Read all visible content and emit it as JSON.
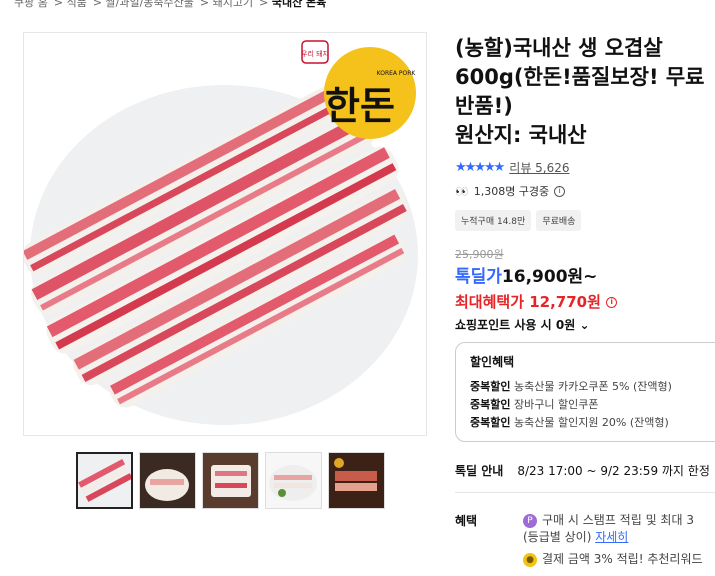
{
  "breadcrumb": [
    "쿠팡 홈",
    "식품",
    "쌀/과일/농축수산물",
    "돼지고기",
    "국내산 돈육"
  ],
  "product": {
    "title": "(농할)국내산 생 오겹살 600g(한돈!품질보장! 무료반품!)",
    "origin": "원산지: 국내산",
    "brand_badge": "우리 돼지",
    "brand_logo_text": "한돈",
    "brand_logo_sub": "KOREA PORK"
  },
  "rating": {
    "stars": "★★★★★",
    "score": 5,
    "review_label": "리뷰 5,626"
  },
  "viewing": "1,308명 구경중",
  "badges": [
    "누적구매 14.8만",
    "무료배송"
  ],
  "price": {
    "original": "25,900원",
    "deal_label": "톡딜가",
    "deal_value": "16,900원~",
    "max_benefit": "최대혜택가 12,770원"
  },
  "points_label": "쇼핑포인트 사용 시 0원",
  "discount": {
    "heading": "할인혜택",
    "rows": [
      {
        "tag": "중복할인",
        "text": "농축산물 카카오쿠폰 5% (잔액형)"
      },
      {
        "tag": "중복할인",
        "text": "장바구니 할인쿠폰"
      },
      {
        "tag": "중복할인",
        "text": "농축산물 할인지원 20% (잔액형)"
      }
    ]
  },
  "timedeal": {
    "label": "톡딜 안내",
    "period": "8/23 17:00 ~ 9/2 23:59 까지 한정"
  },
  "benefit": {
    "label": "혜택",
    "line1": "구매 시 스탬프 적립 및 최대 3",
    "line1b": "(등급별 상이)",
    "line1_link": "자세히",
    "line2": "결제 금액 3% 적립! 추천리워드"
  },
  "colors": {
    "accent": "#346aff",
    "sale": "#e52528"
  }
}
